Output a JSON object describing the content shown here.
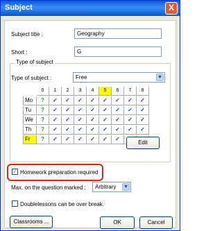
{
  "window": {
    "title": "Subject",
    "close_glyph": "X"
  },
  "fields": {
    "subject_title_label": "Subject title :",
    "subject_title_value": "Geography",
    "short_label": "Short :",
    "short_value": "G"
  },
  "type_group": {
    "legend": "Type of subject",
    "type_label": "Type of subject :",
    "type_value": "Free"
  },
  "timetable": {
    "columns": [
      "0",
      "1",
      "2",
      "3",
      "4",
      "5",
      "6",
      "7",
      "8"
    ],
    "highlighted_column": "5",
    "rows": [
      {
        "day": "Mo",
        "cells": [
          "?",
          "✓",
          "✓",
          "✓",
          "✓",
          "✓",
          "✓",
          "✓",
          "✓"
        ]
      },
      {
        "day": "Tu",
        "cells": [
          "?",
          "✓",
          "✓",
          "✓",
          "✓",
          "✓",
          "✓",
          "✓",
          "✓"
        ]
      },
      {
        "day": "We",
        "cells": [
          "?",
          "✓",
          "✓",
          "✓",
          "✓",
          "✓",
          "✓",
          "✓",
          "✓"
        ]
      },
      {
        "day": "Th",
        "cells": [
          "?",
          "✓",
          "✓",
          "✓",
          "✓",
          "✓",
          "✓",
          "✓",
          "✓"
        ]
      },
      {
        "day": "Fr",
        "cells": [
          "?",
          "✓",
          "✓",
          "✓",
          "✓",
          "✓",
          "✓",
          "✓",
          "✓"
        ]
      }
    ],
    "highlighted_day": "Fr"
  },
  "edit_button": "Edit",
  "homework": {
    "label": "Homework preparation required",
    "checked": true,
    "check_glyph": "✓"
  },
  "max_marked": {
    "label": "Max. on the question marked :",
    "value": "Arbitrary"
  },
  "doublelessons": {
    "label": "Doublelessons can be over break.",
    "checked": false
  },
  "buttons": {
    "classrooms": "Classrooms ...",
    "ok": "OK",
    "cancel": "Cancel"
  },
  "icons": {
    "combo_arrow": "chevron-down-icon"
  },
  "colors": {
    "title_blue": "#0a5bd6",
    "day_yellow": "#ffff00",
    "highlight_red": "#e02020",
    "check_blue": "#1b3f9b",
    "question_green": "#21a121"
  }
}
